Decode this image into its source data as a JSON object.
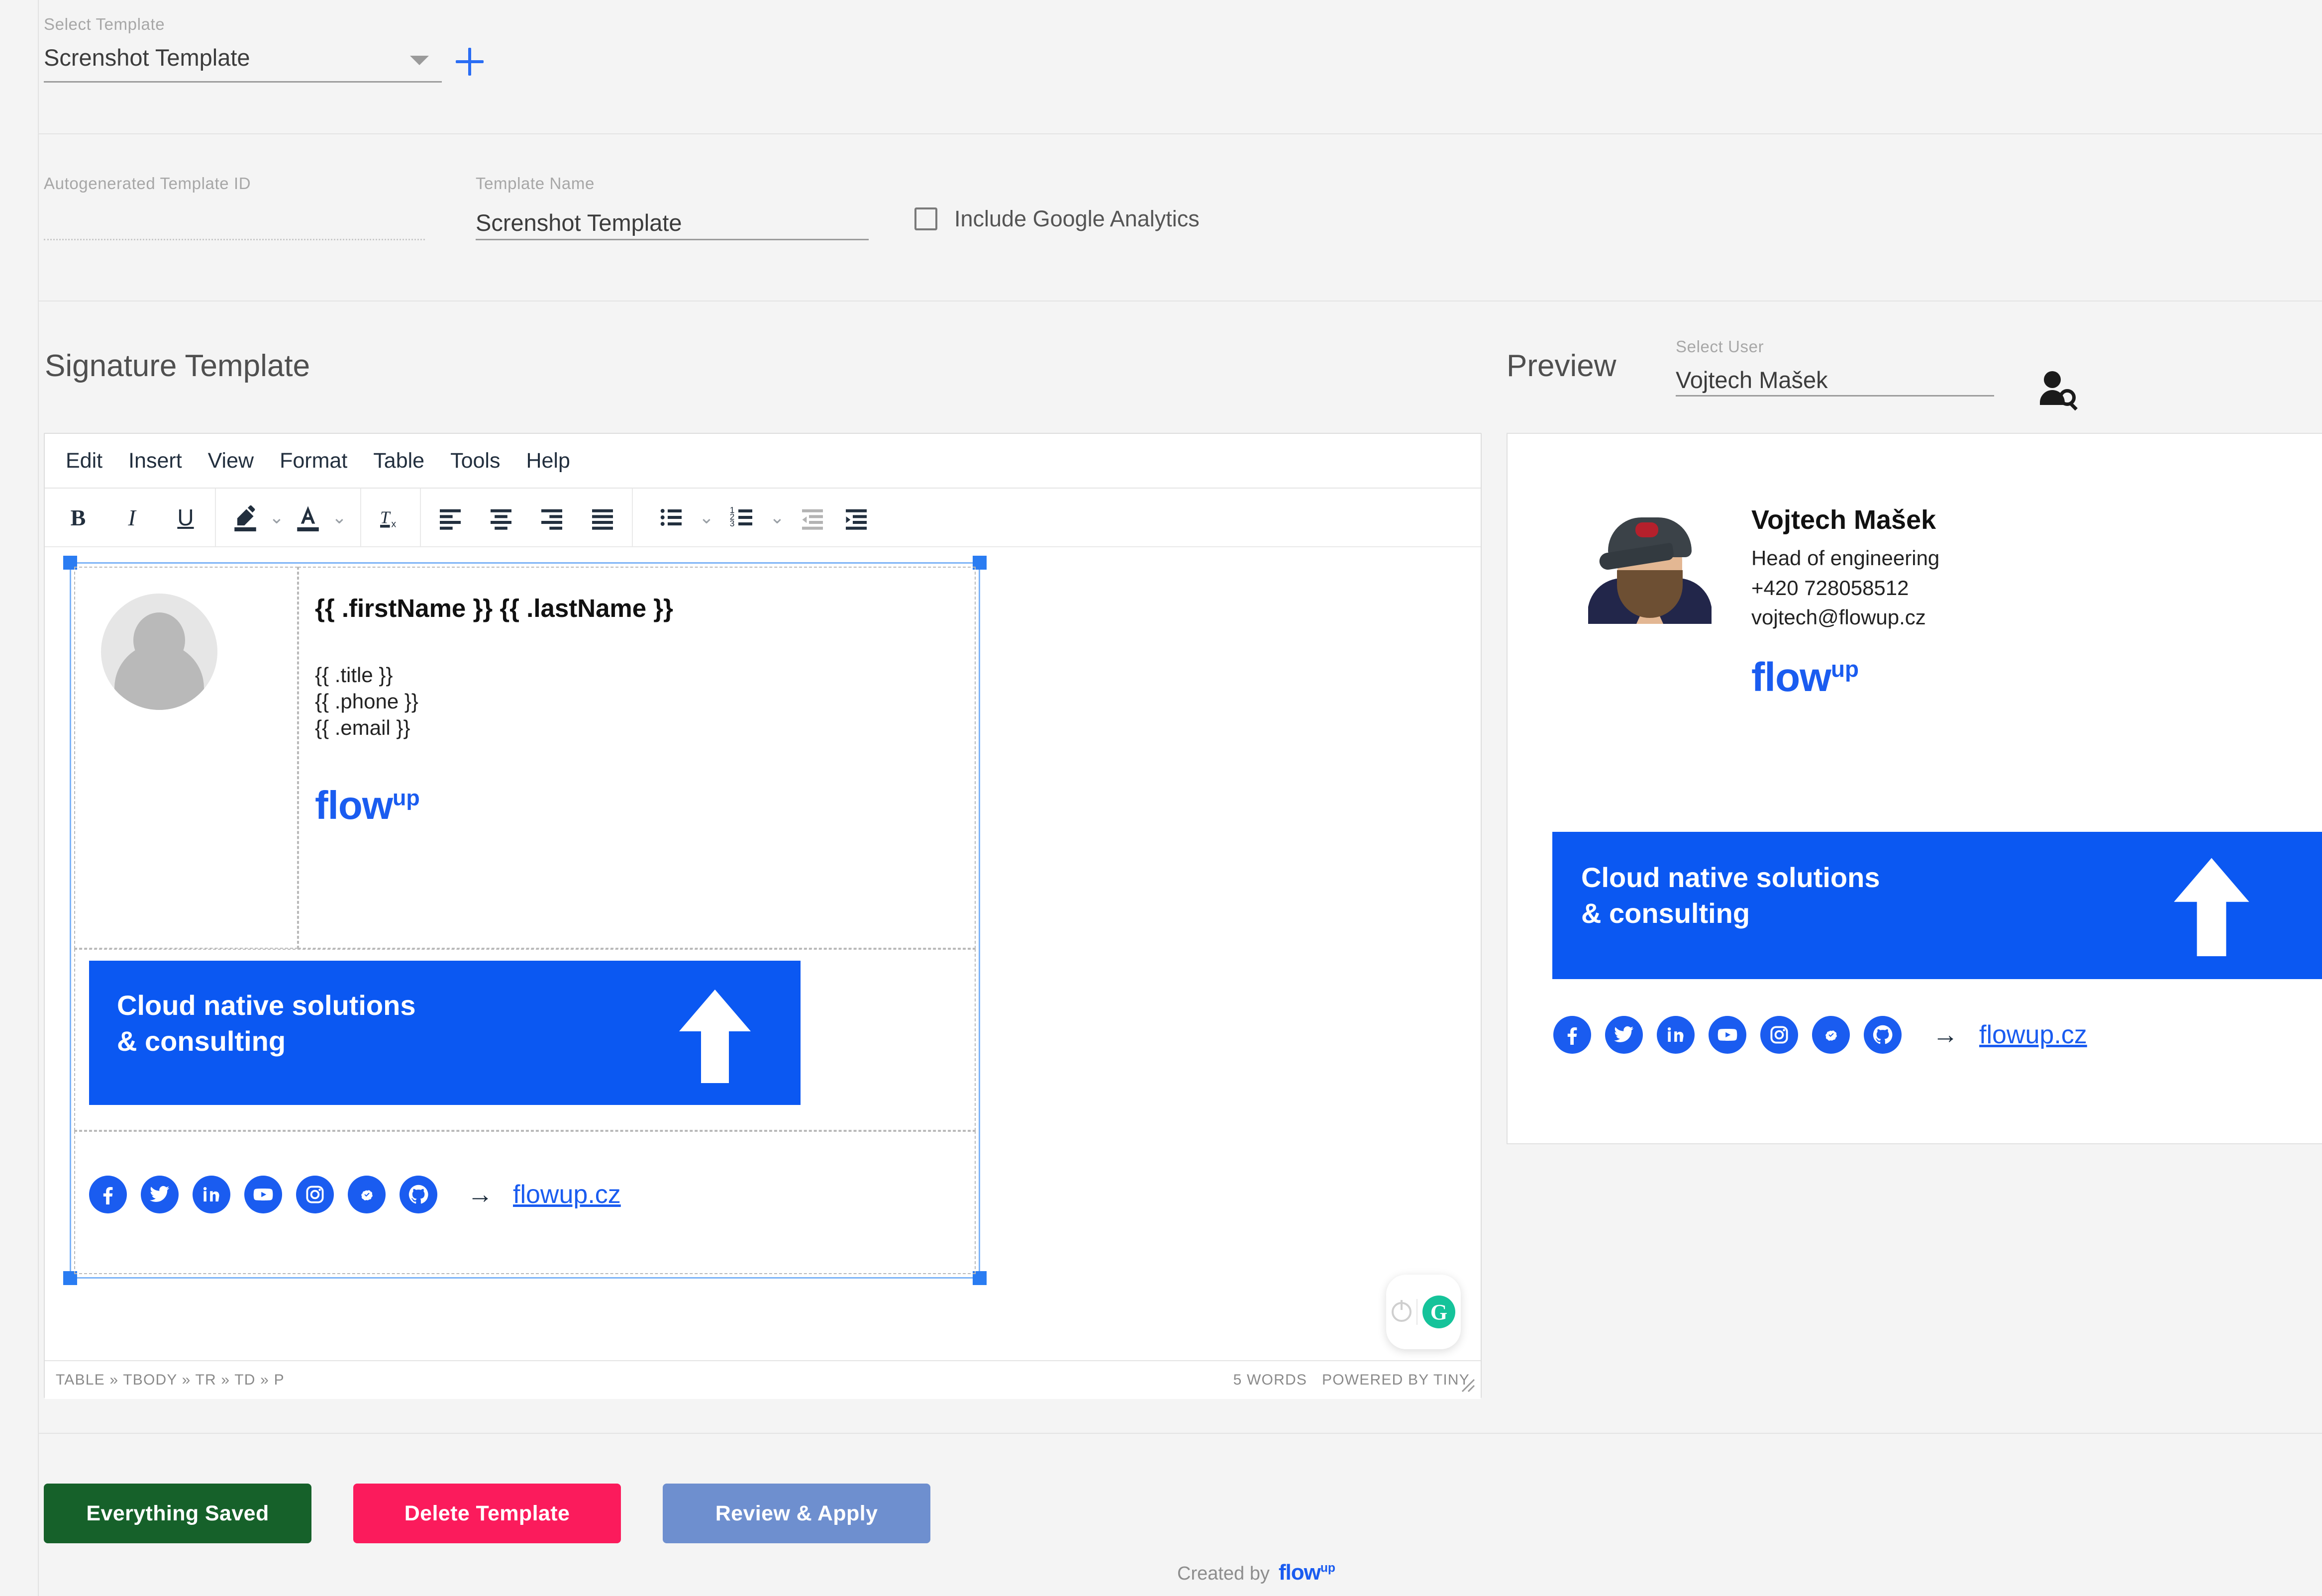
{
  "colors": {
    "page_bg": "#f4f4f4",
    "brand_blue": "#1a5cf0",
    "banner_blue": "#0b58f2",
    "saved_green": "#16612a",
    "delete_pink": "#fb1b5c",
    "apply_blue": "#6e8fcf",
    "grammarly_green": "#15c39a"
  },
  "template_select": {
    "label": "Select Template",
    "value": "Screnshot Template",
    "caret_icon": "chevron-down-icon",
    "add_icon": "plus-icon"
  },
  "template_meta": {
    "id_label": "Autogenerated Template ID",
    "id_value": "",
    "name_label": "Template Name",
    "name_value": "Screnshot Template",
    "analytics_label": "Include Google Analytics",
    "analytics_checked": false
  },
  "signature_section": {
    "heading": "Signature Template"
  },
  "editor": {
    "menus": [
      "Edit",
      "Insert",
      "View",
      "Format",
      "Table",
      "Tools",
      "Help"
    ],
    "toolbar": [
      {
        "name": "bold",
        "glyph": "B"
      },
      {
        "name": "italic",
        "glyph": "I"
      },
      {
        "name": "underline",
        "glyph": "U"
      },
      {
        "name": "background-color",
        "glyph": "pen"
      },
      {
        "name": "background-color-chevron",
        "glyph": "v"
      },
      {
        "name": "text-color",
        "glyph": "A"
      },
      {
        "name": "text-color-chevron",
        "glyph": "v"
      },
      {
        "name": "clear-formatting",
        "glyph": "Tx"
      },
      {
        "name": "align-left",
        "glyph": "align-left"
      },
      {
        "name": "align-center",
        "glyph": "align-center"
      },
      {
        "name": "align-right",
        "glyph": "align-right"
      },
      {
        "name": "align-justify",
        "glyph": "align-justify"
      },
      {
        "name": "bullet-list",
        "glyph": "bullets"
      },
      {
        "name": "bullet-list-chevron",
        "glyph": "v"
      },
      {
        "name": "numbered-list",
        "glyph": "numbers"
      },
      {
        "name": "numbered-list-chevron",
        "glyph": "v"
      },
      {
        "name": "outdent",
        "glyph": "outdent"
      },
      {
        "name": "indent",
        "glyph": "indent"
      }
    ],
    "content": {
      "name_placeholder": "{{ .firstName }} {{ .lastName }}",
      "title_placeholder": "{{ .title }}",
      "phone_placeholder": "{{ .phone }}",
      "email_placeholder": "{{ .email }}",
      "logo_main": "flow",
      "logo_sup": "up",
      "banner_line1": "Cloud native solutions",
      "banner_line2": "& consulting",
      "website": "flowup.cz",
      "arrow": "→"
    },
    "status": {
      "path": "TABLE » TBODY » TR » TD » P",
      "words": "5 WORDS",
      "powered": "POWERED BY TINY"
    }
  },
  "preview": {
    "heading": "Preview",
    "user_label": "Select User",
    "user_value": "Vojtech Mašek",
    "user_icon": "user-search-icon",
    "signature": {
      "name": "Vojtech Mašek",
      "title": "Head of engineering",
      "phone": "+420 728058512",
      "email": "vojtech@flowup.cz",
      "logo_main": "flow",
      "logo_sup": "up",
      "banner_line1": "Cloud native solutions",
      "banner_line2": "& consulting",
      "website": "flowup.cz",
      "arrow": "→"
    }
  },
  "social_icons": [
    {
      "name": "facebook-icon"
    },
    {
      "name": "twitter-icon"
    },
    {
      "name": "linkedin-icon"
    },
    {
      "name": "youtube-icon"
    },
    {
      "name": "instagram-icon"
    },
    {
      "name": "meetup-icon"
    },
    {
      "name": "github-icon"
    }
  ],
  "actions": {
    "saved": "Everything Saved",
    "delete": "Delete Template",
    "apply": "Review & Apply"
  },
  "footer": {
    "created_by": "Created by",
    "logo_main": "flow",
    "logo_sup": "up"
  }
}
